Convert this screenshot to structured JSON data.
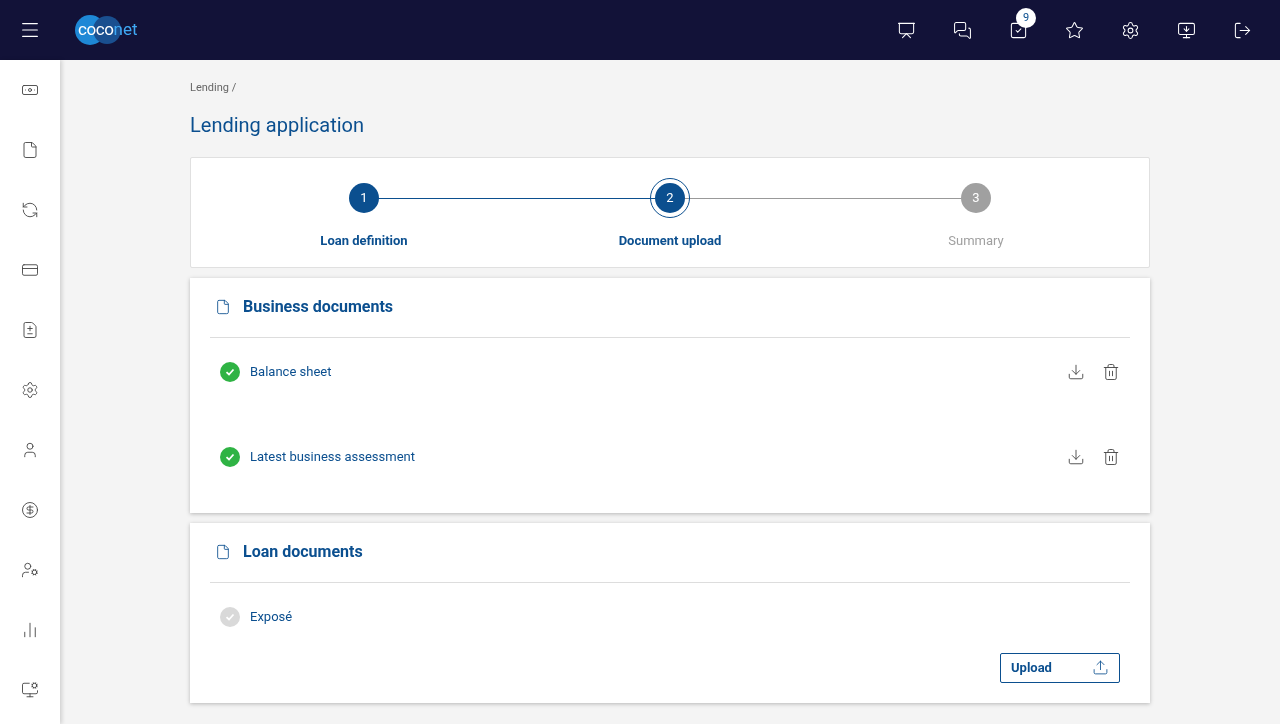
{
  "header": {
    "logo": {
      "part_1": "coco",
      "part_2": "net"
    },
    "tasks_badge": "9"
  },
  "breadcrumb": [
    "Lending /"
  ],
  "page_title": "Lending application",
  "stepper": [
    {
      "number": "1",
      "label": "Loan definition",
      "completed": true,
      "selected": false
    },
    {
      "number": "2",
      "label": "Document upload",
      "completed": false,
      "selected": true
    },
    {
      "number": "3",
      "label": "Summary",
      "completed": false,
      "selected": false
    }
  ],
  "sections": [
    {
      "title": "Business documents",
      "documents": [
        {
          "name": "Balance sheet",
          "uploaded": true
        },
        {
          "name": "Latest business assessment",
          "uploaded": true
        }
      ]
    },
    {
      "title": "Loan documents",
      "documents": [
        {
          "name": "Exposé",
          "uploaded": false,
          "upload_button": "Upload"
        }
      ]
    }
  ]
}
